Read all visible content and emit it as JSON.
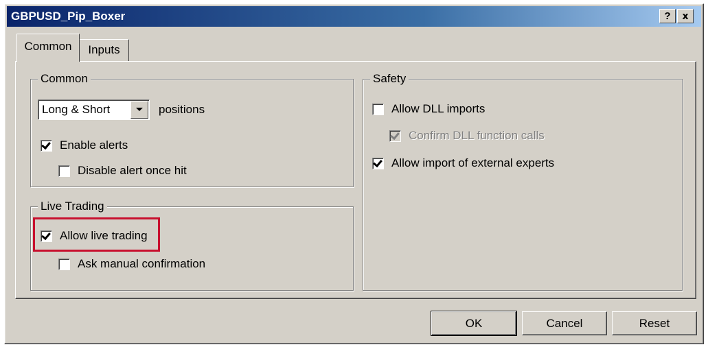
{
  "window": {
    "title": "GBPUSD_Pip_Boxer",
    "help_label": "?",
    "close_label": "x"
  },
  "tabs": [
    {
      "label": "Common",
      "active": true
    },
    {
      "label": "Inputs",
      "active": false
    }
  ],
  "common": {
    "group_title": "Common",
    "positions_select": {
      "value": "Long & Short"
    },
    "positions_label": "positions",
    "enable_alerts": {
      "label": "Enable alerts",
      "checked": true
    },
    "disable_alert_once_hit": {
      "label": "Disable alert once hit",
      "checked": false
    }
  },
  "live_trading": {
    "group_title": "Live Trading",
    "allow_live_trading": {
      "label": "Allow live trading",
      "checked": true
    },
    "ask_manual_confirmation": {
      "label": "Ask manual confirmation",
      "checked": false
    }
  },
  "safety": {
    "group_title": "Safety",
    "allow_dll_imports": {
      "label": "Allow DLL imports",
      "checked": false
    },
    "confirm_dll_function_calls": {
      "label": "Confirm DLL function calls",
      "checked": true,
      "disabled": true
    },
    "allow_import_external_experts": {
      "label": "Allow import of external experts",
      "checked": true
    }
  },
  "buttons": {
    "ok": "OK",
    "cancel": "Cancel",
    "reset": "Reset"
  },
  "colors": {
    "highlight": "#c8102e",
    "titlebar_start": "#0a246a",
    "titlebar_end": "#a6caf0",
    "face": "#d4d0c8"
  }
}
